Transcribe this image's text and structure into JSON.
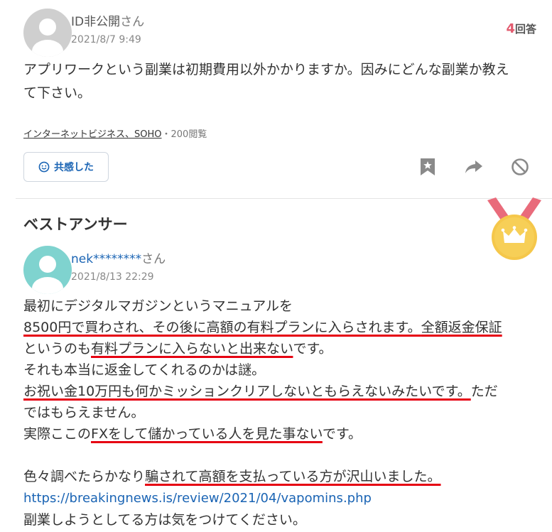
{
  "question": {
    "username": "ID非公開",
    "honorific": "さん",
    "date": "2021/8/7 9:49",
    "answer_count": "4",
    "answer_count_label": "回答",
    "body_line1": "アプリワークという副業は初期費用以外かかりますか。因みにどんな副業か教え",
    "body_line2": "て下さい。",
    "category": "インターネットビジネス、SOHO",
    "views": "・200閲覧",
    "empathy_button": "共感した"
  },
  "best_answer": {
    "title": "ベストアンサー",
    "username": "nek********",
    "honorific": "さん",
    "date": "2021/8/13 22:29",
    "lines": [
      {
        "parts": [
          "最初にデジタルマガジンというマニュアルを"
        ]
      },
      {
        "parts": [
          "8500円で買わされ、その後に高額の有料プランに入らされます。",
          "全額返金保証"
        ]
      },
      {
        "parts": [
          "というのも",
          "有料プランに入らないと出来ない",
          "です。"
        ]
      },
      {
        "parts": [
          "それも本当に返金してくれるのかは謎。"
        ]
      },
      {
        "parts": [
          "お祝い金10万円も何かミッションクリアしないともらえないみたいです。",
          "ただ"
        ]
      },
      {
        "parts": [
          "ではもらえません。"
        ]
      },
      {
        "parts": [
          "実際ここの",
          "FXをして儲かっている人を見た事ない",
          "です。"
        ]
      },
      {
        "parts": [
          ""
        ]
      },
      {
        "parts": [
          "色々調べたらかなり",
          "騙されて高額を支払っている方が沢山いました。"
        ]
      },
      {
        "parts": [
          "https://breakingnews.is/review/2021/04/vapomins.php"
        ]
      },
      {
        "parts": [
          "副業しようとしてる方は気をつけてください。"
        ]
      }
    ]
  },
  "colors": {
    "accent_red": "#e60012",
    "link_blue": "#1a64b4",
    "medal_gold": "#f5c74a",
    "ribbon_pink": "#e96b7b",
    "avatar_gray": "#cfcfcf",
    "avatar_teal": "#7fd3cf"
  },
  "icons": {
    "avatar_default": "person-silhouette-icon",
    "empathy": "smile-icon",
    "bookmark": "bookmark-star-icon",
    "share": "share-arrow-icon",
    "block": "block-icon",
    "medal": "crown-medal-icon"
  }
}
